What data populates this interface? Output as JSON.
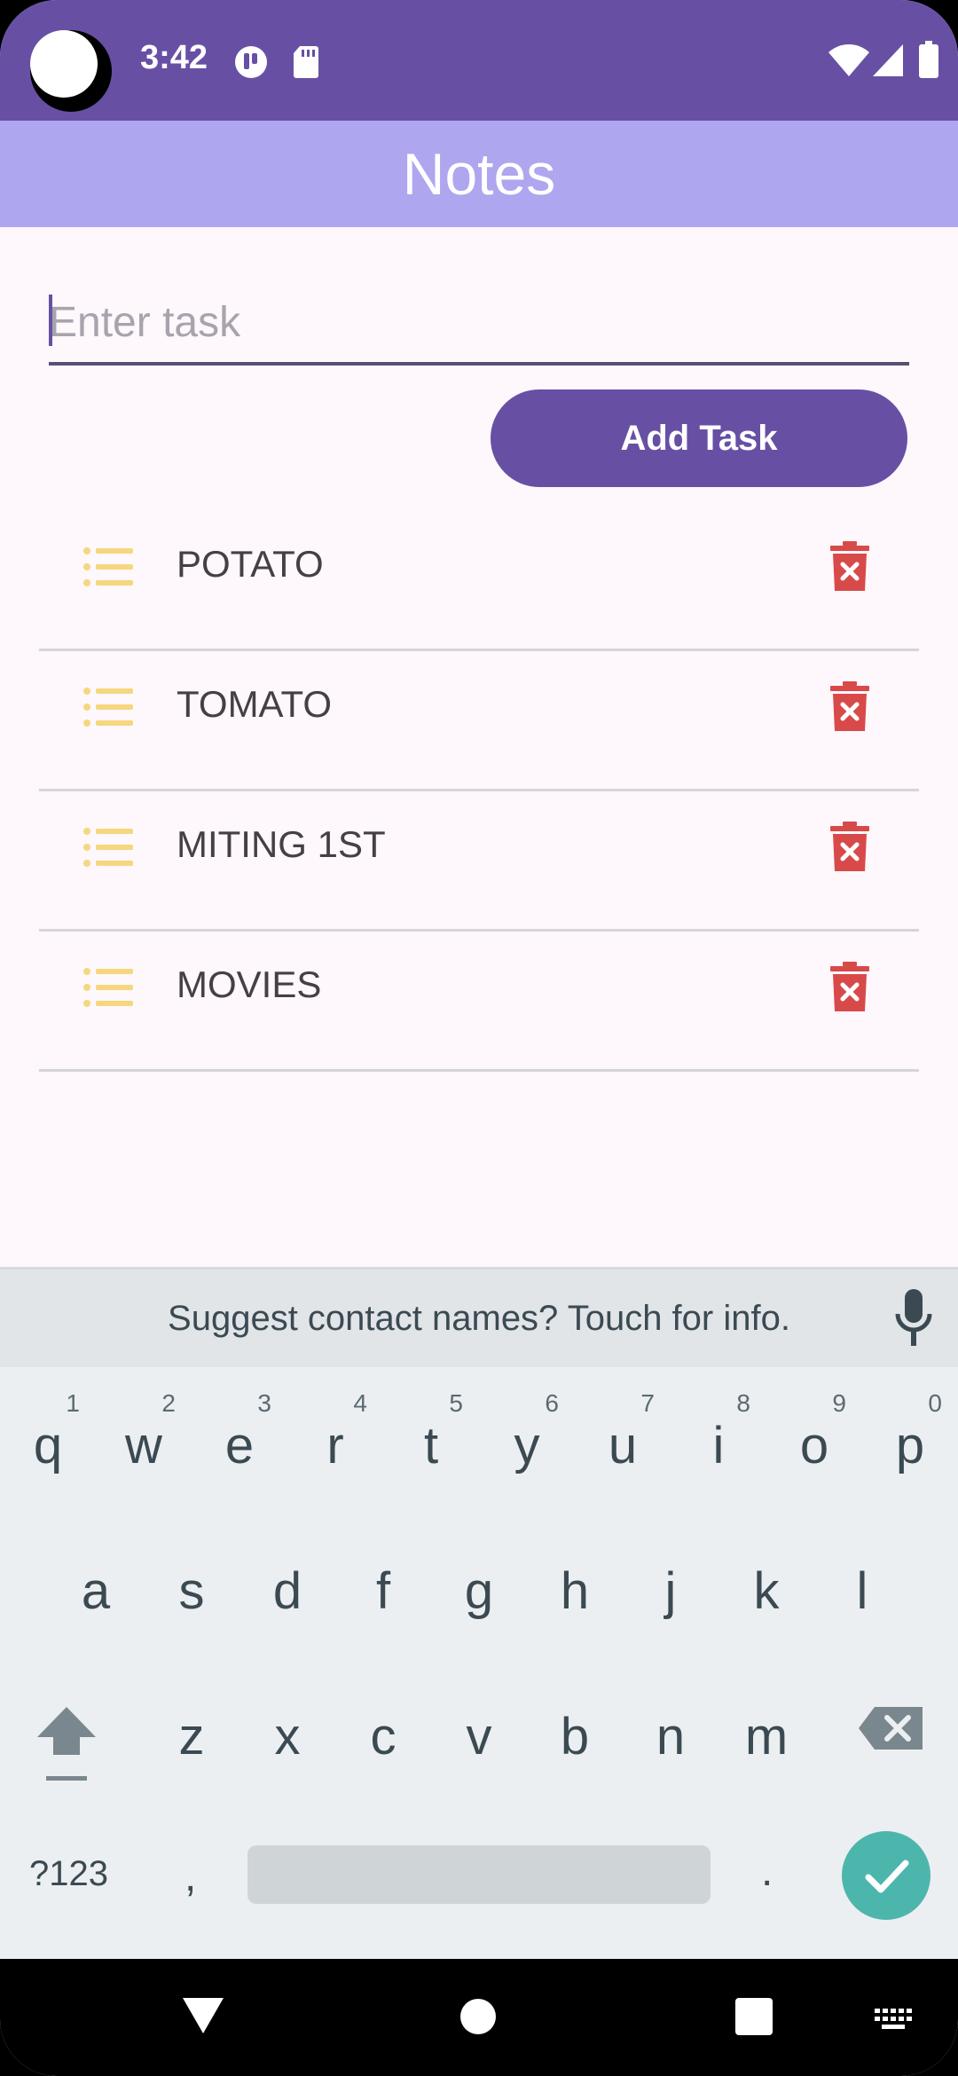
{
  "status_bar": {
    "time": "3:42",
    "icons": [
      "notification-icon",
      "sd-card-icon",
      "wifi-icon",
      "signal-icon",
      "battery-icon"
    ]
  },
  "app_bar": {
    "title": "Notes"
  },
  "task_input": {
    "placeholder": "Enter task",
    "value": ""
  },
  "add_button": {
    "label": "Add Task"
  },
  "tasks": [
    {
      "label": "POTATO",
      "icon": "list-icon",
      "action_icon": "delete-icon"
    },
    {
      "label": "TOMATO",
      "icon": "list-icon",
      "action_icon": "delete-icon"
    },
    {
      "label": "MITING 1ST",
      "icon": "list-icon",
      "action_icon": "delete-icon"
    },
    {
      "label": "MOVIES",
      "icon": "list-icon",
      "action_icon": "delete-icon"
    }
  ],
  "keyboard": {
    "suggestion": "Suggest contact names? Touch for info.",
    "row1": [
      "q",
      "w",
      "e",
      "r",
      "t",
      "y",
      "u",
      "i",
      "o",
      "p"
    ],
    "row1_hints": [
      "1",
      "2",
      "3",
      "4",
      "5",
      "6",
      "7",
      "8",
      "9",
      "0"
    ],
    "row2": [
      "a",
      "s",
      "d",
      "f",
      "g",
      "h",
      "j",
      "k",
      "l"
    ],
    "row3": [
      "z",
      "x",
      "c",
      "v",
      "b",
      "n",
      "m"
    ],
    "symbols_key": "?123",
    "comma_key": ",",
    "period_key": "."
  },
  "colors": {
    "status_bar": "#6750a4",
    "app_bar": "#aea6ef",
    "primary": "#6750a4",
    "list_icon": "#f5d77e",
    "delete_icon": "#d84a4a",
    "enter_key": "#4db6ac"
  }
}
